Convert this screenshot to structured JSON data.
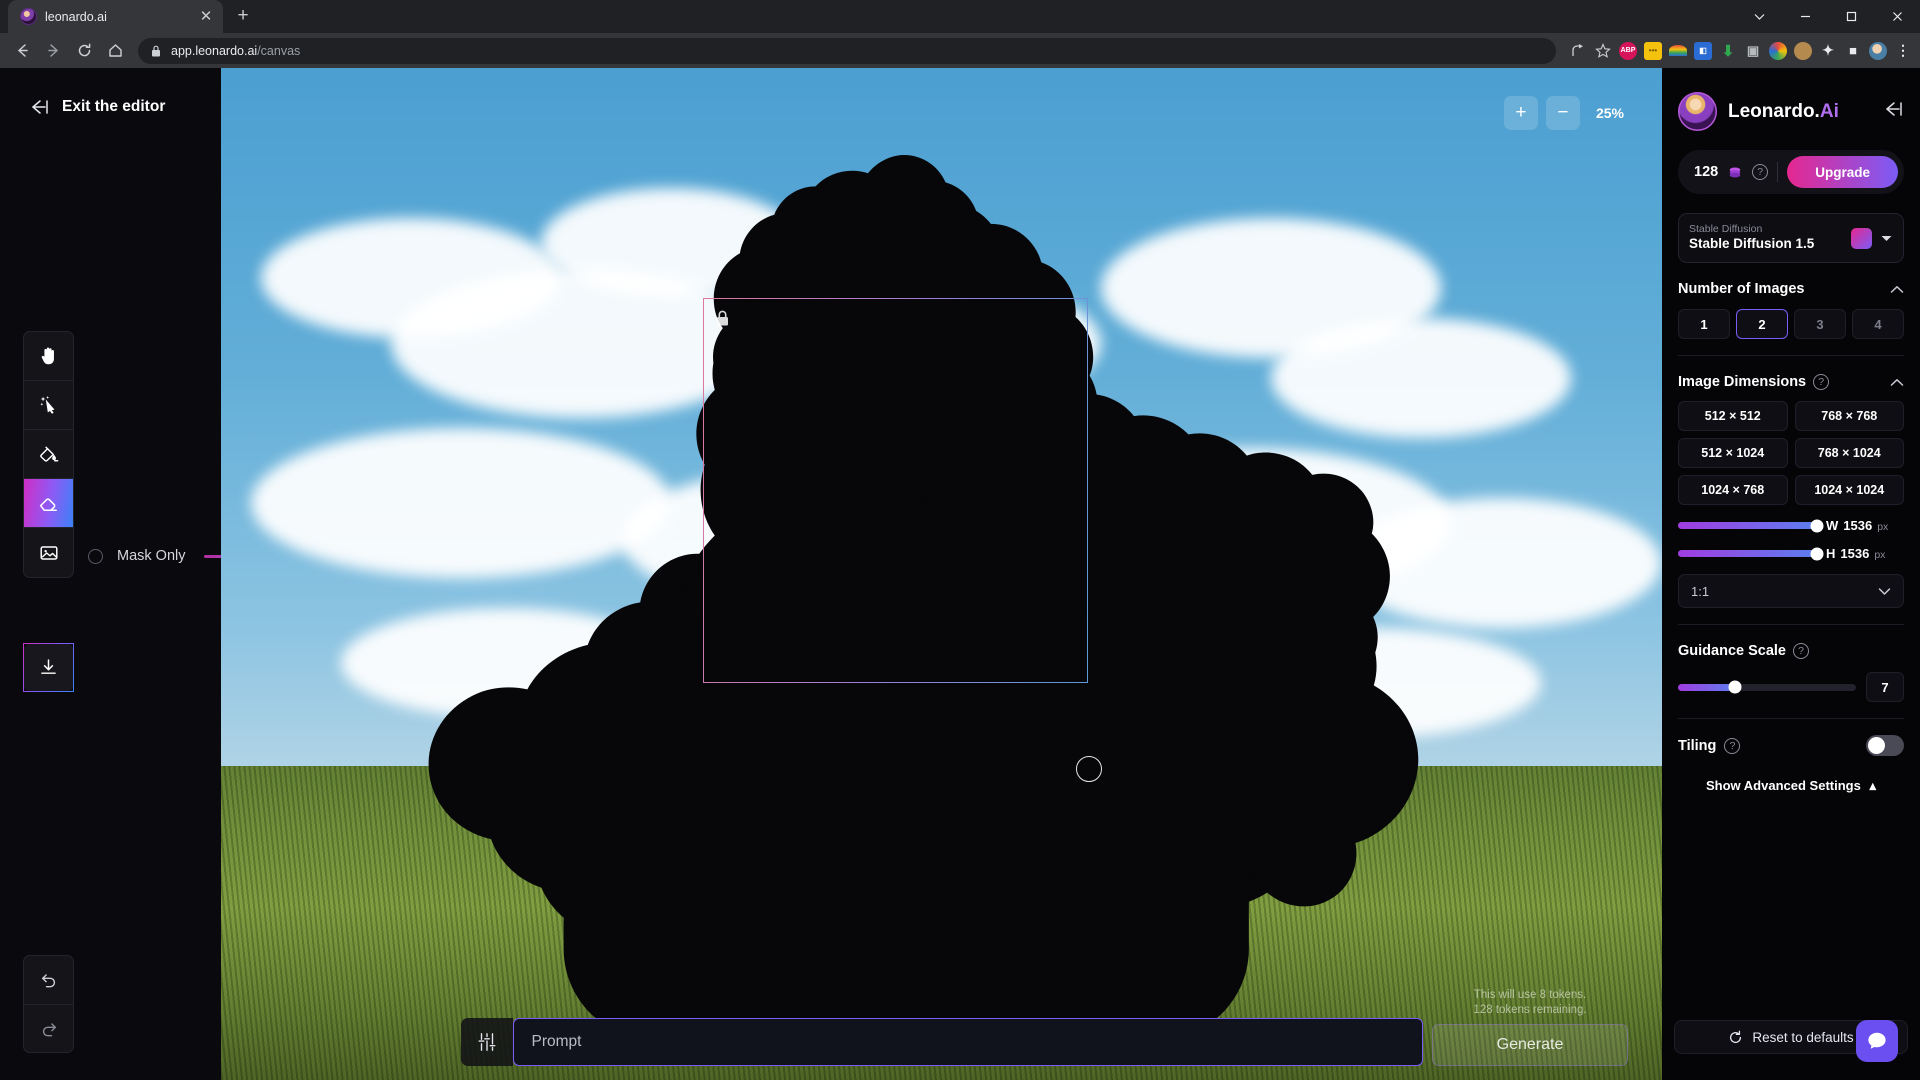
{
  "browser": {
    "tab": {
      "title": "leonardo.ai",
      "favicon": "leonardo-favicon",
      "close": "✕"
    },
    "newtab_label": "+",
    "window": {
      "chevron": "chevron-down-icon",
      "minimize": "minimize-icon",
      "maximize": "maximize-icon",
      "close": "close-icon"
    },
    "url": {
      "domain": "app.leonardo.ai",
      "path": "/canvas",
      "lock": "lock-icon"
    },
    "nav": {
      "back": "back-icon",
      "forward": "forward-icon",
      "reload": "reload-icon",
      "home": "home-icon"
    },
    "extensions": [
      {
        "name": "share-icon",
        "glyph": "➦",
        "color": "#cdd0d4"
      },
      {
        "name": "bookmark-star-icon",
        "glyph": "☆",
        "color": "#cdd0d4"
      },
      {
        "name": "adblock-plus-icon",
        "glyph": "ABP",
        "color": "#d6145a"
      },
      {
        "name": "yellow-notes-icon",
        "glyph": "•••",
        "color": "#f4c20d"
      },
      {
        "name": "rainbow-icon",
        "glyph": "◜",
        "color": "#3aa757"
      },
      {
        "name": "blue-box-icon",
        "glyph": "▣",
        "color": "#2b6cd4"
      },
      {
        "name": "download-helper-icon",
        "glyph": "⬇",
        "color": "#2fa84f"
      },
      {
        "name": "screenshot-camera-icon",
        "glyph": "◱",
        "color": "#9aa0a6"
      },
      {
        "name": "color-wheel-icon",
        "glyph": "◕",
        "color": "#e8861a"
      },
      {
        "name": "cookie-icon",
        "glyph": "●",
        "color": "#b58a4e"
      },
      {
        "name": "puzzle-extensions-icon",
        "glyph": "✦",
        "color": "#e8eaed"
      },
      {
        "name": "square-icon",
        "glyph": "■",
        "color": "#e8eaed"
      },
      {
        "name": "profile-avatar-icon",
        "glyph": "●",
        "color": "#7fb1d4"
      },
      {
        "name": "browser-menu-icon",
        "glyph": "⋮",
        "color": "#e8eaed"
      }
    ]
  },
  "editor": {
    "exit_label": "Exit the editor",
    "tools": [
      {
        "name": "pan-hand-tool",
        "label": "Pan",
        "active": false
      },
      {
        "name": "magic-select-tool",
        "label": "Magic Select",
        "active": false
      },
      {
        "name": "brush-fill-tool",
        "label": "Brush Fill",
        "active": false
      },
      {
        "name": "eraser-tool",
        "label": "Eraser",
        "active": true
      },
      {
        "name": "image-upload-tool",
        "label": "Upload Image",
        "active": false
      }
    ],
    "download_label": "Download",
    "undo_label": "Undo",
    "redo_label": "Redo",
    "mask_only": {
      "label": "Mask Only",
      "slider_percent": 100
    }
  },
  "canvas": {
    "zoom": {
      "plus": "+",
      "minus": "−",
      "level": "25%"
    },
    "selection": {
      "locked_icon": "lock-icon"
    },
    "brush_cursor": "brush-cursor"
  },
  "prompt": {
    "settings_icon": "sliders-icon",
    "placeholder": "Prompt",
    "value": "",
    "generate_label": "Generate",
    "token_note_line1": "This will use 8 tokens.",
    "token_note_line2": "128 tokens remaining."
  },
  "panel": {
    "brand_main": "Leonardo.",
    "brand_accent": "Ai",
    "collapse_icon": "collapse-panel-icon",
    "tokens": {
      "count": "128",
      "coin_icon": "token-coin-icon",
      "help_icon": "help-icon",
      "upgrade_label": "Upgrade"
    },
    "model": {
      "sub": "Stable Diffusion",
      "name": "Stable Diffusion 1.5",
      "thumb": "model-thumbnail",
      "chevron": "chevron-down-icon"
    },
    "number_of_images": {
      "title": "Number of Images",
      "options": [
        "1",
        "2",
        "3",
        "4"
      ],
      "selected": "2"
    },
    "image_dimensions": {
      "title": "Image Dimensions",
      "help_icon": "help-icon",
      "presets": [
        "512 × 512",
        "768 × 768",
        "512 × 1024",
        "768 × 1024",
        "1024 × 768",
        "1024 × 1024"
      ],
      "width": {
        "key": "W",
        "value": "1536",
        "unit": "px",
        "percent": 100
      },
      "height": {
        "key": "H",
        "value": "1536",
        "unit": "px",
        "percent": 100
      },
      "aspect_ratio": "1:1"
    },
    "guidance_scale": {
      "title": "Guidance Scale",
      "help_icon": "help-icon",
      "value": "7",
      "percent": 32
    },
    "tiling": {
      "title": "Tiling",
      "help_icon": "help-icon",
      "enabled": false
    },
    "advanced_label": "Show Advanced Settings",
    "reset_label": "Reset to defaults",
    "chat_icon": "chat-support-icon"
  },
  "colors": {
    "accent_purple": "#7c5cf6",
    "accent_pink": "#e5278f",
    "panel_bg": "#050507",
    "canvas_sky": "#62aed8"
  }
}
